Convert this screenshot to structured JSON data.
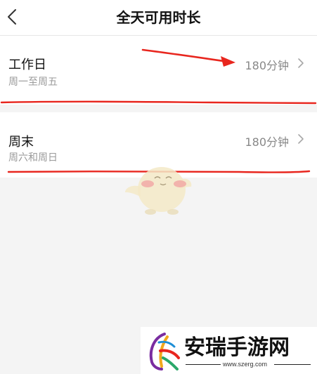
{
  "header": {
    "title": "全天可用时长",
    "back_icon": "chevron-left-icon"
  },
  "rows": [
    {
      "label": "工作日",
      "sub": "周一至周五",
      "value": "180分钟",
      "icon": "chevron-right-icon"
    },
    {
      "label": "周末",
      "sub": "周六和周日",
      "value": "180分钟",
      "icon": "chevron-right-icon"
    }
  ],
  "annotations": {
    "arrow_color": "#e8261e",
    "underline_color": "#e8261e"
  },
  "watermark": {
    "name": "安瑞手游网",
    "url": "www.szerg.com"
  },
  "colors": {
    "background": "#f4f4f4",
    "card": "#ffffff",
    "text": "#111111",
    "secondary_text": "#9a9a9a",
    "annotation_red": "#e8261e"
  }
}
